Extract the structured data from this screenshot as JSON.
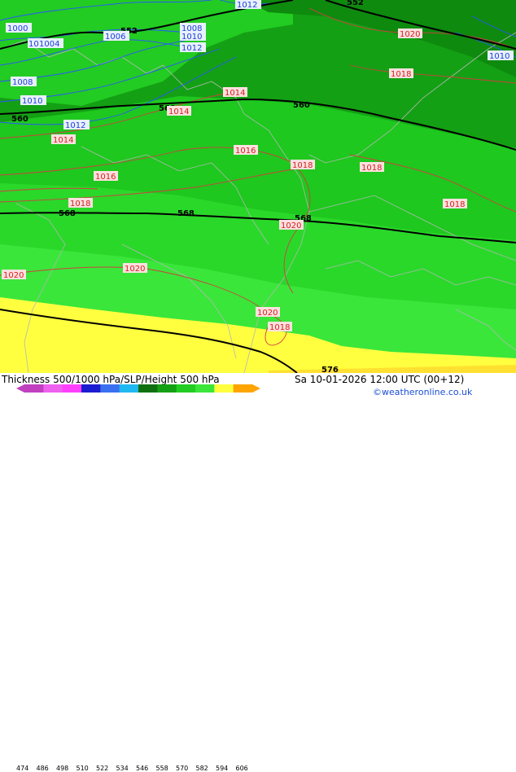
{
  "title": "Thickness 500/1000 hPa/SLP/Height 500 hPa",
  "valid_time": "Sa 10-01-2026 12:00 UTC (00+12)",
  "credit": "©weatheronline.co.uk",
  "legend": {
    "ticks": [
      "474",
      "486",
      "498",
      "510",
      "522",
      "534",
      "546",
      "558",
      "570",
      "582",
      "594",
      "606"
    ],
    "colors": [
      "#c040c0",
      "#ee60ee",
      "#ff40ff",
      "#1c1cd0",
      "#3a70f0",
      "#20b8f0",
      "#107010",
      "#14a014",
      "#22cc22",
      "#3ae63a",
      "#ffff40",
      "#ffa400"
    ]
  },
  "map": {
    "height_labels": [
      "552",
      "552",
      "560",
      "560",
      "560",
      "568",
      "568",
      "568",
      "576"
    ],
    "pressure_labels_red": [
      "1020",
      "1018",
      "1014",
      "1014",
      "1014",
      "1016",
      "1016",
      "1018",
      "1018",
      "1018",
      "1018",
      "1020",
      "1020",
      "1020",
      "1020",
      "1018"
    ],
    "pressure_labels_blue": [
      "1012",
      "1000",
      "1004",
      "1006",
      "1008",
      "1010",
      "1012",
      "1008",
      "1010",
      "1012",
      "1010",
      "1004"
    ]
  }
}
